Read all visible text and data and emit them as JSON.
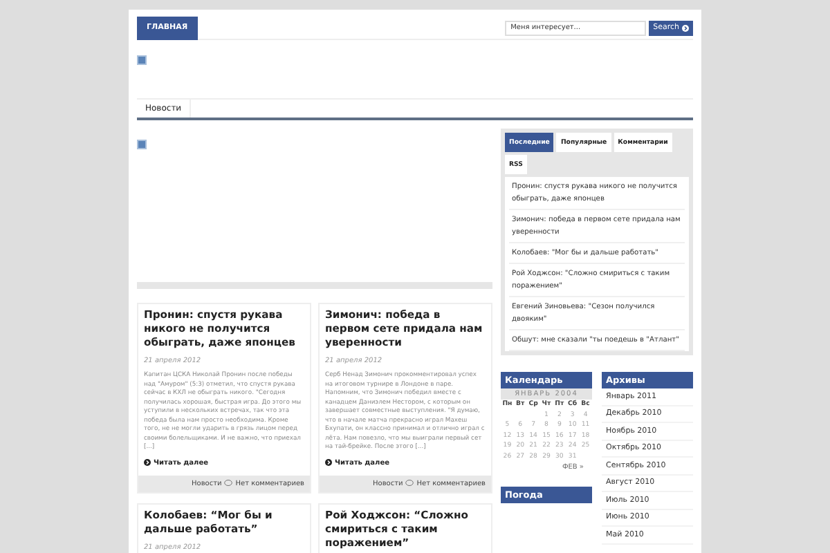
{
  "top_nav": {
    "home": "ГЛАВНАЯ",
    "search": {
      "placeholder": "Меня интересует...",
      "button": "Search"
    }
  },
  "menu": [
    {
      "label": "Новости",
      "selected": false
    }
  ],
  "posts": [
    {
      "title": "Пронин: спустя рукава никого не получится обыграть, даже японцев",
      "date": "21 апреля 2012",
      "excerpt": "Капитан ЦСКА Николай Пронин после победы над \"Амуром\" (5:3) отметил, что спустя рукава сейчас в КХЛ не обыграть никого. \"Сегодня получилась хорошая, быстрая игра. До этого мы уступили в нескольких встречах, так что эта победа была нам просто необходима. Кроме того, не не могли ударить в грязь лицом перед своими болельщиками. И не важно, что приехал [...]",
      "more": "Читать далее",
      "category": "Новости",
      "comments": "Нет комментариев"
    },
    {
      "title": "Зимонич: победа в первом сете придала нам уверенности",
      "date": "21 апреля 2012",
      "excerpt": "Серб Ненад Зимонич прокомментировал успех на итоговом турнире в Лондоне в паре. Напомним, что Зимонич победил вместе с канадцем Даниэлем Нестором, с которым он завершает совместные выступления. \"Я думаю, что в начале матча прекрасно играл Махеш Бхупати, он классно принимал и отлично играл с лёта. Нам повезло, что мы выиграли первый сет на тай-брейке. После этого [...]",
      "more": "Читать далее",
      "category": "Новости",
      "comments": "Нет комментариев"
    },
    {
      "title": "Колобаев: “Мог бы и дальше работать”",
      "date": "21 апреля 2012"
    },
    {
      "title": "Рой Ходжсон: “Сложно смириться с таким поражением”"
    }
  ],
  "sidebar": {
    "tabs": [
      {
        "label": "Последние",
        "selected": true
      },
      {
        "label": "Популярные",
        "selected": false
      },
      {
        "label": "Комментарии",
        "selected": false
      },
      {
        "label": "RSS",
        "selected": false
      }
    ],
    "recent": [
      "Пронин: спустя рукава никого не получится обыграть, даже японцев",
      "Зимонич: победа в первом сете придала нам уверенности",
      "Колобаев: \"Мог бы и дальше работать\"",
      "Рой Ходжсон: \"Сложно смириться с таким поражением\"",
      "Евгений Зиновьева: \"Сезон получился двояким\"",
      "Обшут: мне сказали \"ты поедешь в \"Атлант\""
    ]
  },
  "calendar": {
    "title": "Календарь",
    "month": "ЯНВАРЬ 2004",
    "weekdays": [
      "Пн",
      "Вт",
      "Ср",
      "Чт",
      "Пт",
      "Сб",
      "Вс"
    ],
    "weeks": [
      [
        "1",
        "2",
        "3",
        "4"
      ],
      [
        "5",
        "6",
        "7",
        "8",
        "9",
        "10",
        "11"
      ],
      [
        "12",
        "13",
        "14",
        "15",
        "16",
        "17",
        "18"
      ],
      [
        "19",
        "20",
        "21",
        "22",
        "23",
        "24",
        "25"
      ],
      [
        "26",
        "27",
        "28",
        "29",
        "30",
        "31"
      ]
    ],
    "next": "ФЕВ »"
  },
  "weather": {
    "title": "Погода"
  },
  "archives": {
    "title": "Архивы",
    "items": [
      "Январь 2011",
      "Декабрь 2010",
      "Ноябрь 2010",
      "Октябрь 2010",
      "Сентябрь 2010",
      "Август 2010",
      "Июль 2010",
      "Июнь 2010",
      "Май 2010"
    ]
  }
}
